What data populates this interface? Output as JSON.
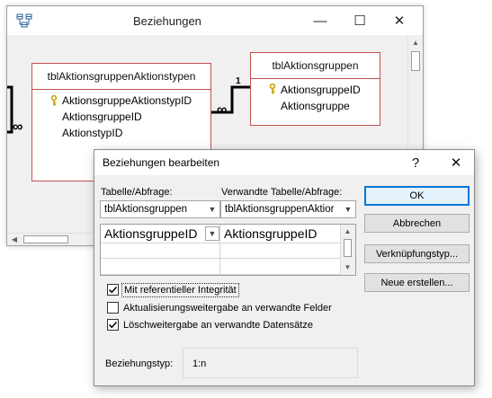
{
  "bg_window": {
    "title": "Beziehungen",
    "caption": {
      "minimize": "—",
      "maximize": "☐",
      "close": "✕"
    },
    "relations": {
      "one_label": "1",
      "many_label": "∞"
    },
    "tables": [
      {
        "name": "tblAktionsgruppenAktionstypen",
        "fields": [
          "AktionsgruppeAktionstypID",
          "AktionsgruppeID",
          "AktionstypID"
        ],
        "primary_key_index": 0
      },
      {
        "name": "tblAktionsgruppen",
        "fields": [
          "AktionsgruppeID",
          "Aktionsgruppe"
        ],
        "primary_key_index": 0
      }
    ]
  },
  "dialog": {
    "title": "Beziehungen bearbeiten",
    "help_button": "?",
    "close_button": "✕",
    "table_label": "Tabelle/Abfrage:",
    "related_label": "Verwandte Tabelle/Abfrage:",
    "table_value": "tblAktionsgruppen",
    "related_value": "tblAktionsgruppenAktior",
    "grid_rows": [
      {
        "left": "AktionsgruppeID",
        "right": "AktionsgruppeID"
      },
      {
        "left": "",
        "right": ""
      },
      {
        "left": "",
        "right": ""
      }
    ],
    "checkboxes": [
      {
        "label": "Mit referentieller Integrität",
        "checked": true,
        "focused": true
      },
      {
        "label": "Aktualisierungsweitergabe an verwandte Felder",
        "checked": false
      },
      {
        "label": "Löschweitergabe an verwandte Datensätze",
        "checked": true
      }
    ],
    "reltype_label": "Beziehungstyp:",
    "reltype_value": "1:n",
    "buttons": {
      "ok": "OK",
      "cancel": "Abbrechen",
      "join_type": "Verknüpfungstyp...",
      "create_new": "Neue erstellen..."
    }
  },
  "colors": {
    "table_border": "#c0504d",
    "relation_line": "#000000",
    "dialog_bg": "#f0f0f0",
    "default_button_border": "#0078d7",
    "key_icon": "#c9a400"
  },
  "icons": {
    "app": "relationships-icon",
    "key": "primary-key-icon",
    "combo": "chevron-down-icon",
    "check": "check-icon"
  }
}
